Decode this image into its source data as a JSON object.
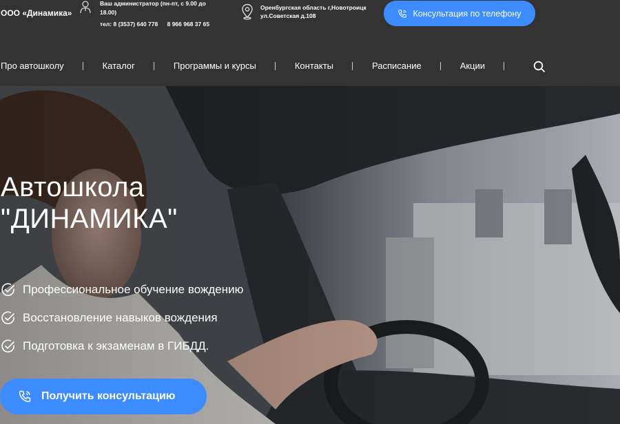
{
  "header": {
    "brand": "ООО «Динамика»",
    "admin_label": "Ваш администратор (пн-пт, с 9.00 до 18.00)",
    "phone_1": "тел: 8 (3537) 640 778",
    "phone_2": "8 966 968 37 65",
    "address_line_1": "Оренбургская область г,Новотроицк",
    "address_line_2": "ул.Советская д.108",
    "call_button": "Консультация по телефону",
    "icons": [
      "administrator-icon",
      "location-pin-icon",
      "phone-icon"
    ]
  },
  "nav": {
    "items": [
      "Про автошколу",
      "Каталог",
      "Программы и курсы",
      "Контакты",
      "Расписание",
      "Акции"
    ],
    "search_icon": "search-icon"
  },
  "hero": {
    "title_line_1": "Автошкола",
    "title_line_2": "\"ДИНАМИКА\"",
    "features": [
      "Профессиональное обучение вождению",
      "Восстановление навыков вождения",
      "Подготовка к экзаменам в ГИБДД."
    ],
    "feature_icon": "check-circle-icon",
    "cta_label": "Получить консультацию",
    "cta_icon": "phone-icon"
  },
  "colors": {
    "header_bg": "#333333",
    "accent": "#3c8cff",
    "text": "#ffffff"
  }
}
